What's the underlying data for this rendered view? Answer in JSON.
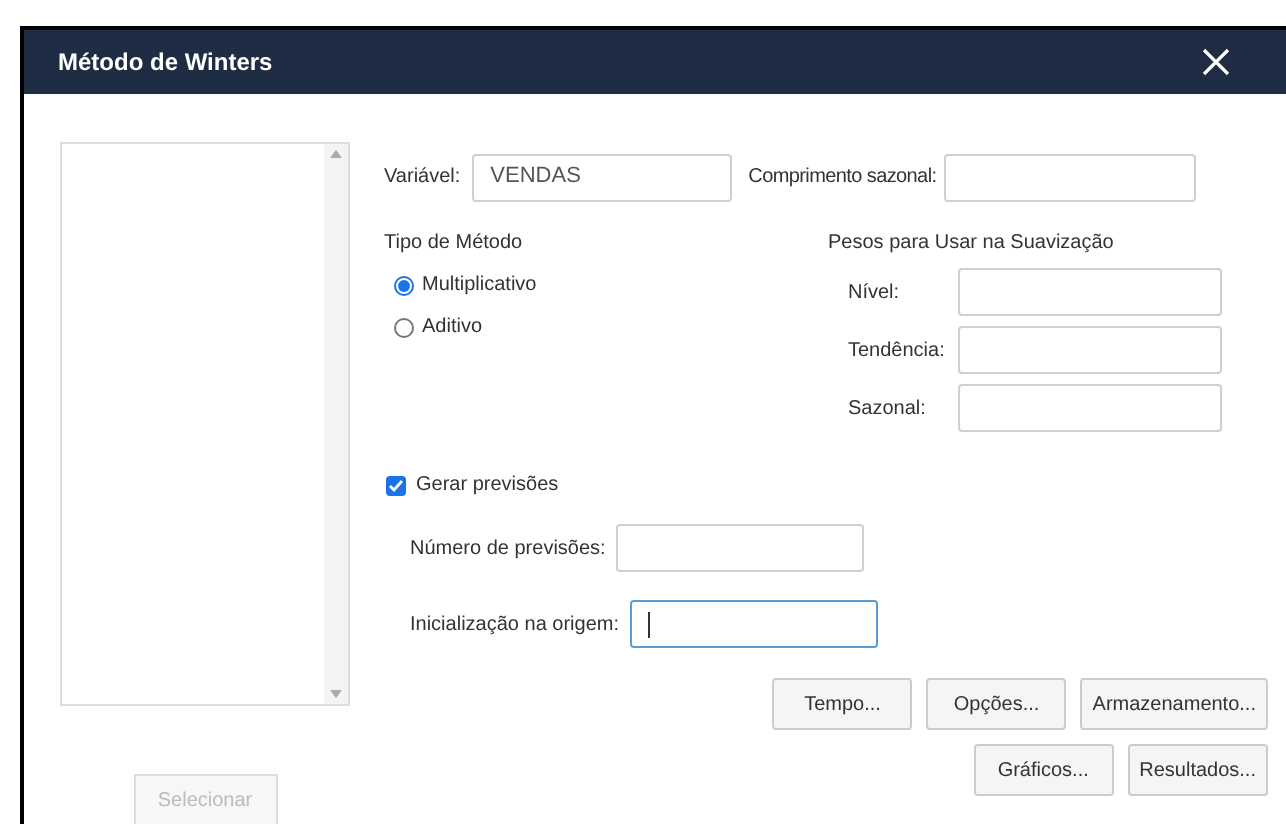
{
  "window": {
    "title": "Método de Winters"
  },
  "select_button": {
    "label": "Selecionar",
    "disabled": true
  },
  "variable": {
    "label": "Variável:",
    "value": "VENDAS"
  },
  "seasonal_length": {
    "label": "Comprimento sazonal:"
  },
  "method_type": {
    "title": "Tipo de Método",
    "options": [
      {
        "label": "Multiplicativo",
        "selected": true
      },
      {
        "label": "Aditivo",
        "selected": false
      }
    ]
  },
  "smoothing_weights": {
    "title": "Pesos para Usar na Suavização",
    "fields": [
      {
        "label": "Nível:"
      },
      {
        "label": "Tendência:"
      },
      {
        "label": "Sazonal:"
      }
    ]
  },
  "generate_forecasts": {
    "label": "Gerar previsões",
    "checked": true
  },
  "forecast_fields": [
    {
      "label": "Número de previsões:",
      "focused": false
    },
    {
      "label": "Inicialização na origem:",
      "focused": true
    }
  ],
  "button_rows": [
    [
      "Tempo...",
      "Opções...",
      "Armazenamento..."
    ],
    [
      "Gráficos...",
      "Resultados..."
    ]
  ]
}
